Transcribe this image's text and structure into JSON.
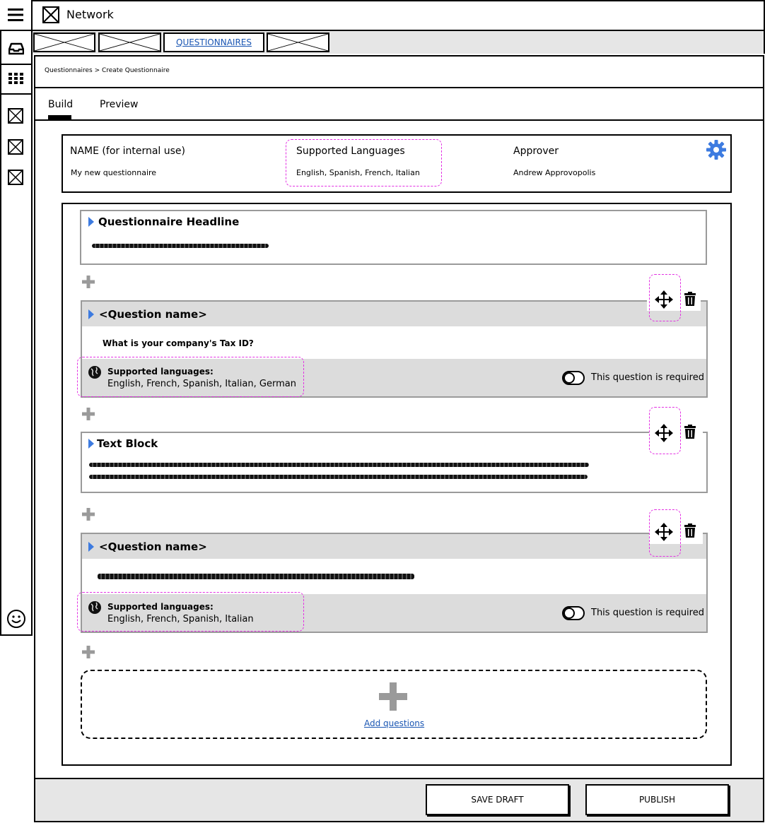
{
  "app": {
    "title": "Network"
  },
  "tabs": {
    "active_label": "QUESTIONNAIRES"
  },
  "breadcrumb": "Questionnaires > Create Questionnaire",
  "view_tabs": {
    "build": "Build",
    "preview": "Preview"
  },
  "info": {
    "name_label": "NAME (for internal use)",
    "name_value": "My new questionnaire",
    "languages_label": "Supported Languages",
    "languages_value": "English, Spanish, French, Italian",
    "approver_label": "Approver",
    "approver_value": "Andrew Approvopolis"
  },
  "blocks": {
    "headline_title": "Questionnaire Headline",
    "question1": {
      "title": "<Question name>",
      "text": "What is your company's Tax ID?",
      "languages_label": "Supported languages:",
      "languages_value": "English, French, Spanish, Italian, German",
      "required_label": "This question is required"
    },
    "textblock_title": "Text Block",
    "question2": {
      "title": "<Question name>",
      "languages_label": "Supported languages:",
      "languages_value": "English, French, Spanish, Italian",
      "required_label": "This question is required"
    }
  },
  "add_questions_label": "Add questions",
  "footer": {
    "save_draft": "SAVE DRAFT",
    "publish": "PUBLISH"
  },
  "colors": {
    "accent": "#3d7be0",
    "link": "#1a56b3",
    "highlight": "#e32fe3",
    "panel_gray": "#dcdcdc"
  }
}
